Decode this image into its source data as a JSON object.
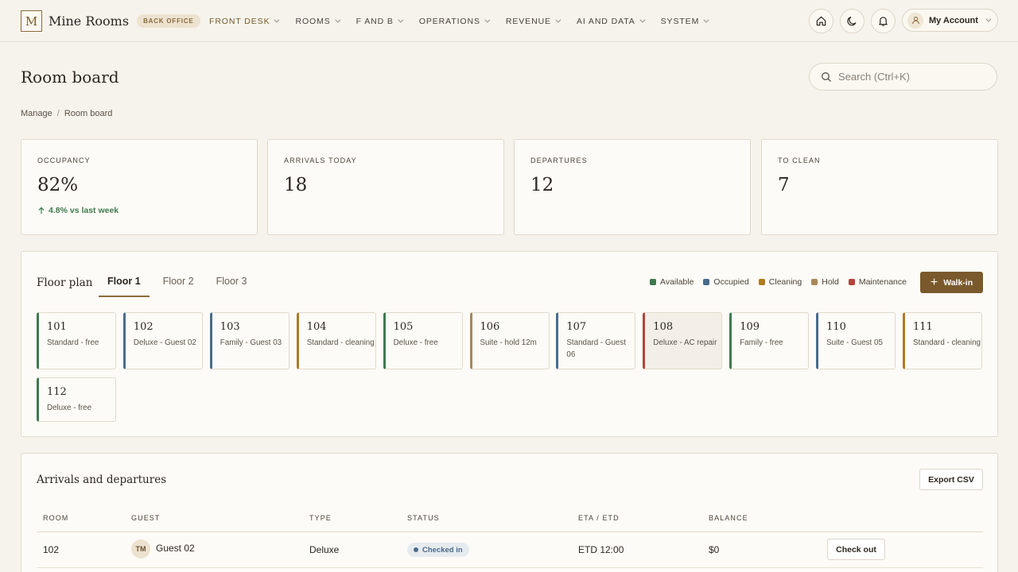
{
  "app": {
    "logo_letter": "M",
    "name": "Mine Rooms",
    "badge": "BACK OFFICE"
  },
  "nav": [
    {
      "label": "FRONT DESK",
      "active": true
    },
    {
      "label": "ROOMS"
    },
    {
      "label": "F AND B"
    },
    {
      "label": "OPERATIONS"
    },
    {
      "label": "REVENUE"
    },
    {
      "label": "AI AND DATA"
    },
    {
      "label": "SYSTEM"
    }
  ],
  "account": {
    "label": "My Account"
  },
  "page": {
    "title": "Room board"
  },
  "search": {
    "placeholder": "Search (Ctrl+K)"
  },
  "breadcrumb": {
    "parent": "Manage",
    "sep": "/",
    "current": "Room board"
  },
  "stats": [
    {
      "label": "OCCUPANCY",
      "value": "82%",
      "trend": "4.8% vs last week"
    },
    {
      "label": "ARRIVALS TODAY",
      "value": "18"
    },
    {
      "label": "DEPARTURES",
      "value": "12"
    },
    {
      "label": "TO CLEAN",
      "value": "7"
    }
  ],
  "floor_plan": {
    "title": "Floor plan",
    "tabs": [
      "Floor 1",
      "Floor 2",
      "Floor 3"
    ],
    "active_tab": 0,
    "legend": [
      {
        "label": "Available",
        "color": "#3f7a4f"
      },
      {
        "label": "Occupied",
        "color": "#4a6b8a"
      },
      {
        "label": "Cleaning",
        "color": "#b07a22"
      },
      {
        "label": "Hold",
        "color": "#a8875a"
      },
      {
        "label": "Maintenance",
        "color": "#b5433a"
      }
    ],
    "walkin_label": "Walk-in",
    "rooms": [
      {
        "num": "101",
        "desc": "Standard - free",
        "status": "available"
      },
      {
        "num": "102",
        "desc": "Deluxe - Guest 02",
        "status": "occupied"
      },
      {
        "num": "103",
        "desc": "Family - Guest 03",
        "status": "occupied"
      },
      {
        "num": "104",
        "desc": "Standard - cleaning",
        "status": "cleaning"
      },
      {
        "num": "105",
        "desc": "Deluxe - free",
        "status": "available"
      },
      {
        "num": "106",
        "desc": "Suite - hold 12m",
        "status": "hold"
      },
      {
        "num": "107",
        "desc": "Standard - Guest 06",
        "status": "occupied"
      },
      {
        "num": "108",
        "desc": "Deluxe - AC repair",
        "status": "maintenance"
      },
      {
        "num": "109",
        "desc": "Family - free",
        "status": "available"
      },
      {
        "num": "110",
        "desc": "Suite - Guest 05",
        "status": "occupied"
      },
      {
        "num": "111",
        "desc": "Standard - cleaning",
        "status": "cleaning"
      },
      {
        "num": "112",
        "desc": "Deluxe - free",
        "status": "available"
      }
    ]
  },
  "arrivals": {
    "title": "Arrivals and departures",
    "export_label": "Export CSV",
    "columns": [
      "ROOM",
      "GUEST",
      "TYPE",
      "STATUS",
      "ETA / ETD",
      "BALANCE"
    ],
    "rows": [
      {
        "room": "102",
        "initials": "TM",
        "guest": "Guest 02",
        "type": "Deluxe",
        "status": "Checked in",
        "time": "ETD 12:00",
        "balance": "$0",
        "action": "Check out"
      }
    ]
  }
}
